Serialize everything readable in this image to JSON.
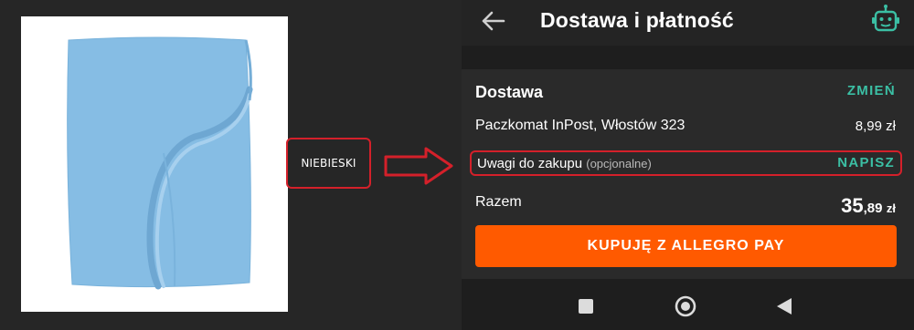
{
  "left_panel": {
    "color_label": "NIEBIESKI",
    "product_color": "#86bde4",
    "highlight_color": "#d4202a"
  },
  "app": {
    "header": {
      "title": "Dostawa i płatność",
      "back_icon": "arrow-left-icon",
      "assistant_icon": "robot-icon"
    },
    "delivery": {
      "section_title": "Dostawa",
      "change_label": "ZMIEŃ",
      "method": "Paczkomat InPost, Włostów 323",
      "price": "8,99 zł"
    },
    "notes": {
      "label": "Uwagi do zakupu",
      "optional": "(opcjonalne)",
      "action_label": "NAPISZ"
    },
    "total": {
      "label": "Razem",
      "amount_main": "35",
      "amount_cents": ",89",
      "currency": "zł"
    },
    "pay_button": {
      "label": "KUPUJĘ Z ALLEGRO PAY"
    },
    "navbar": {
      "recents_icon": "square-icon",
      "home_icon": "circle-icon",
      "back_icon": "triangle-back-icon"
    }
  },
  "colors": {
    "accent_teal": "#3bbfa4",
    "primary_orange": "#ff5a00",
    "background": "#1e1e1e"
  }
}
